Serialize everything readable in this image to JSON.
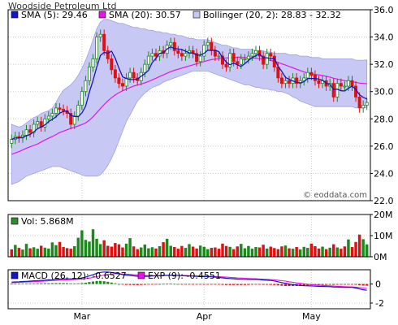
{
  "chart_title": "Woodside Petroleum Ltd",
  "watermark": "© eoddata.com",
  "colors": {
    "sma5": "#1414c8",
    "sma20": "#e614e6",
    "band_fill": "#c8c8f5",
    "band_edge": "#a0a0e6",
    "up": "#1a8a1a",
    "down": "#e01010",
    "volume": "#2e8b2e",
    "macd": "#1414c8",
    "exp": "#e614e6"
  },
  "x_axis": {
    "month_labels": [
      {
        "label": "Mar",
        "index": 19
      },
      {
        "label": "Apr",
        "index": 52
      },
      {
        "label": "May",
        "index": 81
      }
    ]
  },
  "chart_data": [
    {
      "type": "candlestick",
      "panel": "price",
      "legend": [
        {
          "key": "sma5",
          "label": "SMA (5): 29.46"
        },
        {
          "key": "sma20",
          "label": "SMA (20): 30.57"
        },
        {
          "key": "band",
          "label": "Bollinger (20, 2): 28.83 - 32.32"
        }
      ],
      "ylim": [
        22,
        36
      ],
      "yticks": [
        22.0,
        24.0,
        26.0,
        28.0,
        30.0,
        32.0,
        34.0,
        36.0
      ],
      "close": [
        26.5,
        26.7,
        26.6,
        26.8,
        27.2,
        27.0,
        27.6,
        27.8,
        27.4,
        28.0,
        28.2,
        28.4,
        28.8,
        28.7,
        28.6,
        28.4,
        27.6,
        28.2,
        29.0,
        30.0,
        30.8,
        31.8,
        32.4,
        34.0,
        34.2,
        33.0,
        32.4,
        31.6,
        31.0,
        30.6,
        30.4,
        31.0,
        31.4,
        31.0,
        30.8,
        31.4,
        32.0,
        32.6,
        32.8,
        32.6,
        33.0,
        32.8,
        33.4,
        33.6,
        33.0,
        32.8,
        32.6,
        32.8,
        33.0,
        32.8,
        32.2,
        32.6,
        33.4,
        33.6,
        33.0,
        32.6,
        32.6,
        32.0,
        31.8,
        32.8,
        32.2,
        32.0,
        32.4,
        32.4,
        32.6,
        32.8,
        33.0,
        32.6,
        32.0,
        32.8,
        32.6,
        31.8,
        31.0,
        30.6,
        30.8,
        30.6,
        31.0,
        30.6,
        30.8,
        31.0,
        31.4,
        31.2,
        30.8,
        30.6,
        30.8,
        30.4,
        30.6,
        29.6,
        30.6,
        30.4,
        30.4,
        30.8,
        30.4,
        29.6,
        28.8,
        29.0,
        29.2
      ],
      "sma5": [
        26.5,
        26.6,
        26.6,
        26.65,
        26.76,
        26.86,
        27.04,
        27.28,
        27.4,
        27.56,
        27.8,
        27.96,
        28.16,
        28.42,
        28.54,
        28.58,
        28.26,
        28.18,
        28.16,
        28.44,
        28.92,
        29.96,
        30.8,
        31.8,
        32.64,
        32.88,
        32.8,
        32.96,
        32.44,
        31.72,
        31.08,
        30.96,
        30.88,
        30.88,
        30.92,
        31.12,
        31.32,
        31.56,
        32.12,
        32.44,
        32.8,
        32.84,
        33.12,
        33.28,
        33.16,
        33.12,
        33.08,
        32.96,
        32.84,
        32.82,
        32.68,
        32.68,
        32.8,
        33.04,
        33.02,
        33.04,
        32.92,
        32.5,
        32.16,
        31.96,
        32.1,
        31.96,
        31.84,
        32.04,
        32.28,
        32.48,
        32.64,
        32.76,
        32.48,
        32.48,
        32.42,
        32.44,
        31.84,
        31.48,
        31.04,
        30.9,
        30.78,
        30.68,
        30.64,
        30.72,
        30.96,
        30.96,
        30.96,
        30.92,
        30.82,
        30.62,
        30.52,
        30.16,
        30.18,
        30.06,
        30.04,
        30.24,
        30.4,
        30.16,
        29.76,
        29.58,
        29.46
      ],
      "sma20": [
        25.4,
        25.5,
        25.6,
        25.72,
        25.85,
        25.95,
        26.05,
        26.15,
        26.3,
        26.45,
        26.58,
        26.7,
        26.85,
        27.0,
        27.1,
        27.2,
        27.3,
        27.38,
        27.48,
        27.58,
        27.7,
        27.9,
        28.15,
        28.45,
        28.75,
        29.05,
        29.32,
        29.55,
        29.75,
        29.92,
        30.06,
        30.18,
        30.3,
        30.4,
        30.48,
        30.56,
        30.64,
        30.74,
        30.86,
        30.98,
        31.1,
        31.22,
        31.35,
        31.46,
        31.56,
        31.64,
        31.72,
        31.8,
        31.88,
        31.96,
        32.04,
        32.12,
        32.2,
        32.28,
        32.34,
        32.38,
        32.42,
        32.44,
        32.46,
        32.48,
        32.5,
        32.52,
        32.52,
        32.5,
        32.48,
        32.46,
        32.44,
        32.42,
        32.38,
        32.34,
        32.28,
        32.22,
        32.14,
        32.04,
        31.94,
        31.84,
        31.74,
        31.64,
        31.54,
        31.44,
        31.36,
        31.3,
        31.26,
        31.22,
        31.18,
        31.12,
        31.06,
        30.98,
        30.92,
        30.86,
        30.8,
        30.76,
        30.72,
        30.68,
        30.62,
        30.6,
        30.57
      ],
      "bb_upper": [
        27.6,
        27.5,
        27.4,
        27.5,
        27.7,
        27.9,
        28.1,
        28.2,
        28.4,
        28.5,
        28.6,
        28.8,
        29.2,
        29.7,
        30.1,
        30.3,
        30.5,
        30.8,
        31.2,
        31.7,
        32.3,
        33.0,
        33.8,
        34.6,
        35.1,
        35.3,
        35.3,
        35.2,
        35.1,
        35.0,
        35.0,
        34.9,
        34.8,
        34.7,
        34.7,
        34.6,
        34.6,
        34.5,
        34.5,
        34.4,
        34.4,
        34.3,
        34.3,
        34.2,
        34.2,
        34.1,
        34.1,
        34.0,
        33.9,
        33.9,
        33.8,
        33.8,
        33.8,
        33.8,
        33.7,
        33.6,
        33.5,
        33.4,
        33.4,
        33.3,
        33.2,
        33.2,
        33.1,
        33.1,
        33.1,
        33.1,
        33.0,
        33.0,
        33.0,
        32.9,
        32.9,
        32.8,
        32.8,
        32.8,
        32.8,
        32.7,
        32.7,
        32.7,
        32.6,
        32.6,
        32.6,
        32.5,
        32.5,
        32.5,
        32.4,
        32.4,
        32.4,
        32.4,
        32.4,
        32.4,
        32.4,
        32.4,
        32.4,
        32.3,
        32.3,
        32.3,
        32.32
      ],
      "bb_lower": [
        23.2,
        23.3,
        23.4,
        23.6,
        23.8,
        23.9,
        24.0,
        24.1,
        24.2,
        24.3,
        24.4,
        24.5,
        24.5,
        24.5,
        24.4,
        24.3,
        24.2,
        24.1,
        24.0,
        23.9,
        23.8,
        23.8,
        23.8,
        23.8,
        23.9,
        24.2,
        24.6,
        25.1,
        25.7,
        26.4,
        27.1,
        27.8,
        28.3,
        28.8,
        29.3,
        29.6,
        29.9,
        30.1,
        30.3,
        30.4,
        30.5,
        30.7,
        30.8,
        30.9,
        31.0,
        31.1,
        31.2,
        31.3,
        31.4,
        31.5,
        31.5,
        31.5,
        31.5,
        31.5,
        31.4,
        31.3,
        31.2,
        31.1,
        31.0,
        30.9,
        30.8,
        30.7,
        30.6,
        30.5,
        30.5,
        30.4,
        30.3,
        30.3,
        30.2,
        30.2,
        30.1,
        30.1,
        30.0,
        30.0,
        29.9,
        29.8,
        29.6,
        29.5,
        29.3,
        29.2,
        29.1,
        29.0,
        28.9,
        28.9,
        28.9,
        28.9,
        28.9,
        28.9,
        28.9,
        28.9,
        28.9,
        28.9,
        28.9,
        28.8,
        28.8,
        28.8,
        28.83
      ]
    },
    {
      "type": "bar",
      "panel": "volume",
      "legend": [
        {
          "key": "volume",
          "label": "Vol: 5.868M"
        }
      ],
      "ylim": [
        0,
        20
      ],
      "yticks": [
        "0M",
        "10M",
        "20M"
      ],
      "unit": "M",
      "values": [
        3.5,
        5.6,
        4.2,
        3.4,
        6.1,
        4.0,
        4.5,
        3.8,
        5.2,
        4.3,
        3.9,
        6.8,
        5.5,
        7.0,
        4.6,
        4.1,
        3.8,
        5.0,
        9.0,
        12.5,
        8.0,
        7.2,
        13.0,
        8.5,
        6.0,
        7.8,
        5.2,
        4.8,
        6.5,
        5.9,
        4.4,
        6.2,
        8.8,
        4.9,
        3.6,
        4.4,
        5.8,
        4.0,
        4.5,
        3.9,
        5.0,
        6.9,
        8.5,
        5.2,
        4.6,
        3.8,
        5.1,
        4.2,
        6.0,
        4.8,
        3.9,
        5.3,
        4.7,
        3.6,
        4.2,
        4.4,
        3.8,
        6.2,
        5.1,
        4.7,
        3.6,
        4.9,
        6.1,
        4.0,
        5.1,
        3.8,
        4.6,
        4.4,
        5.7,
        3.9,
        4.8,
        4.1,
        3.6,
        4.9,
        5.3,
        4.0,
        3.8,
        4.6,
        3.5,
        4.7,
        4.2,
        6.2,
        5.0,
        3.9,
        4.8,
        3.6,
        4.3,
        5.9,
        4.4,
        3.8,
        4.9,
        8.2,
        4.6,
        7.0,
        10.5,
        8.3,
        5.87
      ],
      "direction": [
        -1,
        1,
        -1,
        1,
        1,
        -1,
        1,
        1,
        -1,
        1,
        1,
        1,
        1,
        -1,
        -1,
        -1,
        -1,
        1,
        1,
        1,
        1,
        1,
        1,
        1,
        1,
        -1,
        -1,
        -1,
        -1,
        -1,
        -1,
        1,
        1,
        -1,
        -1,
        1,
        1,
        1,
        1,
        -1,
        1,
        -1,
        1,
        1,
        -1,
        -1,
        -1,
        1,
        1,
        -1,
        -1,
        1,
        1,
        1,
        -1,
        -1,
        -1,
        -1,
        -1,
        1,
        -1,
        -1,
        1,
        1,
        1,
        1,
        1,
        -1,
        -1,
        1,
        -1,
        -1,
        -1,
        -1,
        1,
        -1,
        1,
        -1,
        1,
        1,
        1,
        -1,
        -1,
        -1,
        1,
        -1,
        1,
        -1,
        1,
        -1,
        -1,
        1,
        -1,
        -1,
        -1,
        1,
        1
      ]
    },
    {
      "type": "line",
      "panel": "macd",
      "legend": [
        {
          "key": "macd",
          "label": "MACD (26, 12): -0.6527"
        },
        {
          "key": "exp",
          "label": "EXP (9): -0.4551"
        }
      ],
      "ylim": [
        -2.6,
        1.5
      ],
      "yticks": [
        -2,
        0
      ],
      "macd": [
        0.2,
        0.22,
        0.24,
        0.26,
        0.28,
        0.3,
        0.33,
        0.36,
        0.38,
        0.41,
        0.44,
        0.46,
        0.49,
        0.52,
        0.54,
        0.55,
        0.54,
        0.55,
        0.58,
        0.64,
        0.72,
        0.85,
        0.98,
        1.12,
        1.22,
        1.26,
        1.26,
        1.22,
        1.16,
        1.08,
        0.99,
        0.94,
        0.9,
        0.86,
        0.82,
        0.81,
        0.81,
        0.82,
        0.84,
        0.86,
        0.88,
        0.9,
        0.92,
        0.93,
        0.92,
        0.9,
        0.88,
        0.86,
        0.85,
        0.83,
        0.8,
        0.78,
        0.78,
        0.78,
        0.76,
        0.73,
        0.7,
        0.65,
        0.6,
        0.58,
        0.55,
        0.52,
        0.5,
        0.49,
        0.48,
        0.48,
        0.48,
        0.46,
        0.42,
        0.4,
        0.37,
        0.32,
        0.24,
        0.15,
        0.07,
        0.0,
        -0.06,
        -0.11,
        -0.15,
        -0.18,
        -0.19,
        -0.2,
        -0.22,
        -0.24,
        -0.25,
        -0.27,
        -0.28,
        -0.32,
        -0.32,
        -0.34,
        -0.35,
        -0.34,
        -0.35,
        -0.42,
        -0.52,
        -0.6,
        -0.65
      ],
      "exp": [
        0.15,
        0.16,
        0.18,
        0.19,
        0.21,
        0.23,
        0.25,
        0.27,
        0.29,
        0.31,
        0.34,
        0.36,
        0.38,
        0.41,
        0.43,
        0.45,
        0.46,
        0.48,
        0.5,
        0.53,
        0.57,
        0.62,
        0.69,
        0.77,
        0.86,
        0.94,
        1.0,
        1.05,
        1.07,
        1.08,
        1.06,
        1.04,
        1.01,
        0.98,
        0.95,
        0.92,
        0.9,
        0.88,
        0.88,
        0.88,
        0.88,
        0.88,
        0.89,
        0.9,
        0.9,
        0.9,
        0.9,
        0.89,
        0.88,
        0.87,
        0.86,
        0.84,
        0.83,
        0.82,
        0.81,
        0.79,
        0.77,
        0.75,
        0.72,
        0.7,
        0.67,
        0.64,
        0.62,
        0.6,
        0.58,
        0.56,
        0.55,
        0.53,
        0.51,
        0.49,
        0.47,
        0.44,
        0.4,
        0.35,
        0.3,
        0.24,
        0.18,
        0.12,
        0.07,
        0.02,
        -0.02,
        -0.06,
        -0.09,
        -0.12,
        -0.15,
        -0.17,
        -0.19,
        -0.22,
        -0.24,
        -0.26,
        -0.28,
        -0.29,
        -0.3,
        -0.33,
        -0.37,
        -0.42,
        -0.4551
      ]
    }
  ]
}
